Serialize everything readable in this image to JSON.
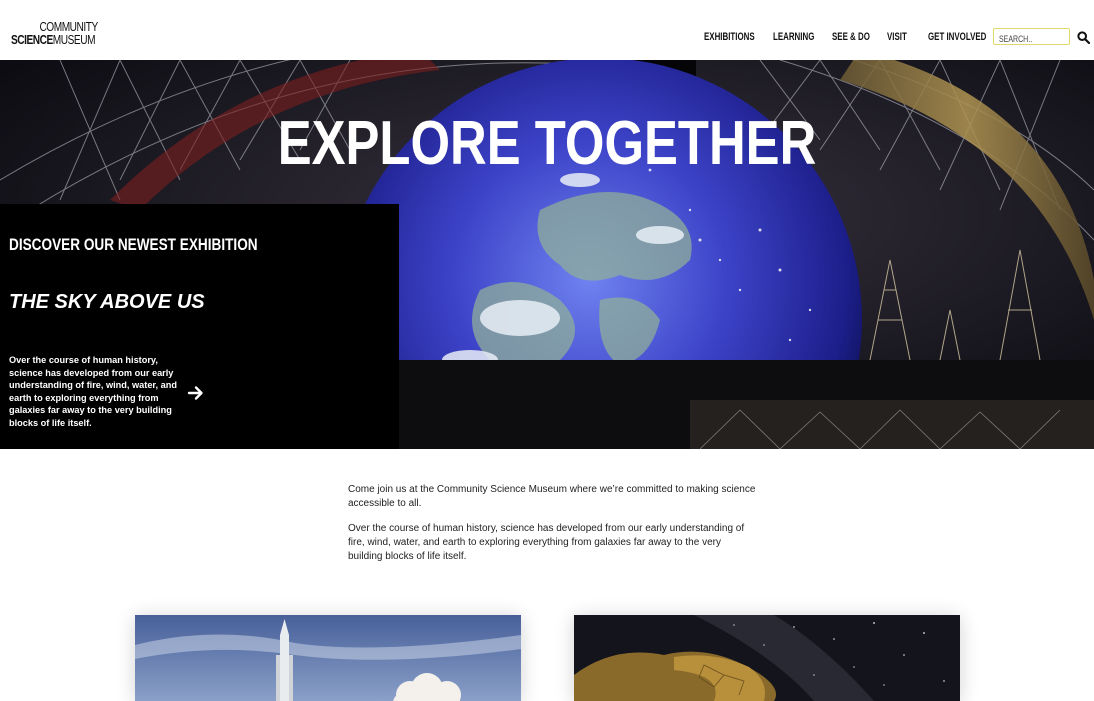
{
  "header": {
    "logo_line1": "COMMUNITY",
    "logo_line2_bold": "SCIENCE",
    "logo_line2_rest": "MUSEUM",
    "nav": [
      "EXHIBITIONS",
      "LEARNING",
      "SEE & DO",
      "VISIT",
      "GET INVOLVED"
    ],
    "search_placeholder": "SEARCH..",
    "search_icon": "magnifier-icon"
  },
  "hero": {
    "title": "EXPLORE TOGETHER",
    "panel": {
      "kicker": "DISCOVER OUR NEWEST EXHIBITION",
      "exhibition_name": "THE SKY ABOVE US",
      "description": "Over the course of human history, science has developed from our early understanding of fire, wind, water, and earth to exploring everything from galaxies far away to the very building blocks of life itself.",
      "arrow_icon": "arrow-right-icon"
    }
  },
  "intro": {
    "paragraph1": "Come join us at the Community Science Museum where we’re committed to making science accessible to all.",
    "paragraph2": "Over the course of human history, science has developed from our early understanding of fire, wind, water, and earth to exploring everything from galaxies far away to the very building blocks of life itself."
  },
  "colors": {
    "header_bg": "#ffffff",
    "panel_bg": "#000000",
    "search_border": "#e3d86a",
    "text": "#111111"
  }
}
